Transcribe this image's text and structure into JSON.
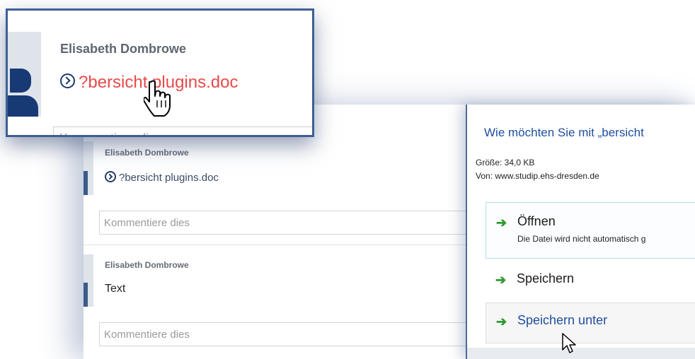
{
  "feed": {
    "posts": [
      {
        "author": "Elisabeth Dombrowe",
        "link_text": "?bersicht plugins.doc",
        "comment_placeholder": "Kommentiere dies"
      },
      {
        "author": "Elisabeth Dombrowe",
        "text": "Text",
        "comment_placeholder": "Kommentiere dies"
      }
    ]
  },
  "dialog": {
    "title": "Wie möchten Sie mit „bersicht",
    "size": "Größe: 34,0 KB",
    "source": "Von: www.studip.ehs-dresden.de",
    "options": [
      {
        "label": "Öffnen",
        "sub": "Die Datei wird nicht automatisch g",
        "icon": "green-arrow-icon"
      },
      {
        "label": "Speichern",
        "icon": "green-arrow-icon"
      },
      {
        "label": "Speichern unter",
        "icon": "green-arrow-icon"
      }
    ]
  },
  "callout": {
    "author": "Elisabeth Dombrowe",
    "link_text": "?bersicht plugins.doc",
    "comment_partial": "Kommentiere dies",
    "link_color": "#e84a4a",
    "border_color": "#3d5f94"
  },
  "colors": {
    "accent_blue": "#1f4fa0",
    "arrow_green": "#2f9a2f",
    "avatar_navy": "#173a75"
  },
  "icons": {
    "link_icon": "chevron-circle-icon",
    "hand_cursor": "hand-pointer-icon",
    "arrow_cursor": "arrow-pointer-icon"
  }
}
